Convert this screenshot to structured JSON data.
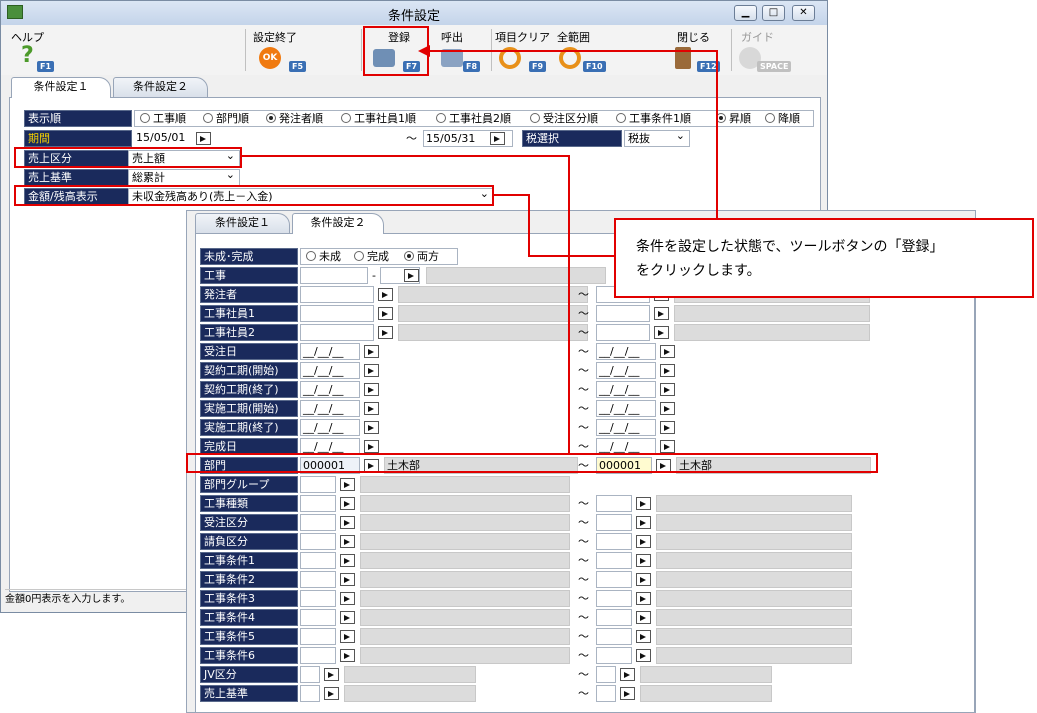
{
  "window": {
    "title": "条件設定",
    "status": "金額0円表示を入力します。"
  },
  "toolbar": [
    {
      "label": "ヘルプ",
      "key": "F1"
    },
    {
      "label": "設定終了",
      "key": "F5"
    },
    {
      "label": "登録",
      "key": "F7"
    },
    {
      "label": "呼出",
      "key": "F8"
    },
    {
      "label": "項目クリア",
      "key": "F9"
    },
    {
      "label": "全範囲",
      "key": "F10"
    },
    {
      "label": "閉じる",
      "key": "F12"
    },
    {
      "label": "ガイド",
      "key": "SPACE"
    }
  ],
  "tabs": {
    "tab1": "条件設定１",
    "tab2": "条件設定２"
  },
  "panel1": {
    "order": {
      "label": "表示順",
      "options": [
        "工事順",
        "部門順",
        "発注者順",
        "工事社員1順",
        "工事社員2順",
        "受注区分順",
        "工事条件1順"
      ],
      "selected": "発注者順",
      "dir": [
        "昇順",
        "降順"
      ],
      "dir_selected": "昇順"
    },
    "period": {
      "label": "期間",
      "from": "15/05/01",
      "to": "15/05/31",
      "tilde": "～"
    },
    "tax": {
      "label": "税選択",
      "value": "税抜"
    },
    "sales_kind": {
      "label": "売上区分",
      "value": "売上額"
    },
    "sales_basis": {
      "label": "売上基準",
      "value": "総累計"
    },
    "amount": {
      "label": "金額/残高表示",
      "value": "未収金残高あり(売上－入金)"
    }
  },
  "panel2": {
    "status_row": {
      "label": "未成･完成",
      "options": [
        "未成",
        "完成",
        "両方"
      ],
      "selected": "両方"
    },
    "rows": [
      {
        "label": "工事",
        "sep": "-"
      },
      {
        "label": "発注者",
        "tilde": "～"
      },
      {
        "label": "工事社員1",
        "tilde": "～"
      },
      {
        "label": "工事社員2",
        "tilde": "～"
      },
      {
        "label": "受注日",
        "from": "__/__/__",
        "to": "__/__/__",
        "tilde": "～"
      },
      {
        "label": "契約工期(開始)",
        "from": "__/__/__",
        "to": "__/__/__",
        "tilde": "～"
      },
      {
        "label": "契約工期(終了)",
        "from": "__/__/__",
        "to": "__/__/__",
        "tilde": "～"
      },
      {
        "label": "実施工期(開始)",
        "from": "__/__/__",
        "to": "__/__/__",
        "tilde": "～"
      },
      {
        "label": "実施工期(終了)",
        "from": "__/__/__",
        "to": "__/__/__",
        "tilde": "～"
      },
      {
        "label": "完成日",
        "from": "__/__/__",
        "to": "__/__/__",
        "tilde": "～"
      },
      {
        "label": "部門",
        "from": "000001",
        "from_name": "土木部",
        "to": "000001",
        "to_name": "土木部",
        "tilde": "～"
      },
      {
        "label": "部門グループ"
      },
      {
        "label": "工事種類",
        "tilde": "～"
      },
      {
        "label": "受注区分",
        "tilde": "～"
      },
      {
        "label": "請負区分",
        "tilde": "～"
      },
      {
        "label": "工事条件1",
        "tilde": "～"
      },
      {
        "label": "工事条件2",
        "tilde": "～"
      },
      {
        "label": "工事条件3",
        "tilde": "～"
      },
      {
        "label": "工事条件4",
        "tilde": "～"
      },
      {
        "label": "工事条件5",
        "tilde": "～"
      },
      {
        "label": "工事条件6",
        "tilde": "～"
      },
      {
        "label": "JV区分",
        "tilde": "～"
      },
      {
        "label": "売上基準",
        "tilde": "～"
      }
    ]
  },
  "callout": {
    "line1": "条件を設定した状態で、ツールボタンの「登録」",
    "line2": "をクリックします。"
  }
}
